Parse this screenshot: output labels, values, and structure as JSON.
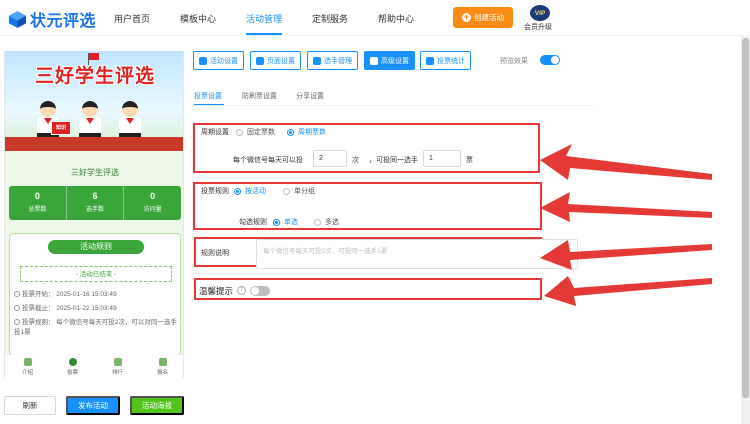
{
  "brand": {
    "name": "状元评选",
    "color": "#1a73e8"
  },
  "nav": {
    "items": [
      "用户首页",
      "模板中心",
      "活动管理",
      "定制服务",
      "帮助中心"
    ],
    "active_index": 2,
    "create_btn": "创建活动",
    "vip_badge": "VIP",
    "vip_label": "会员升级"
  },
  "preview": {
    "banner_title": "三好学生评选",
    "book_text": "知识",
    "poster_name": "三好学生评选",
    "stats": [
      {
        "value": "0",
        "label": "总票数"
      },
      {
        "value": "6",
        "label": "选手数"
      },
      {
        "value": "0",
        "label": "访问量"
      }
    ],
    "rules_title": "活动规则",
    "rules_status": "- 活动已结束 -",
    "rules": [
      "投票开始： 2025-01-16 15:03:49",
      "投票截止： 2025-01-22 15:03:49",
      "投票规则： 每个微信号每天可投2次，可以对同一选手投1票"
    ],
    "tabbar": [
      "介绍",
      "投票",
      "排行",
      "报名"
    ],
    "active_tab": 1
  },
  "footer_buttons": {
    "refresh": "刷新",
    "publish": "发布活动",
    "poster": "活动海报"
  },
  "toolbar": {
    "buttons": [
      "活动设置",
      "页面设置",
      "选手管理",
      "高级设置",
      "投票统计"
    ],
    "active_index": 3,
    "preview_label": "预览效果",
    "preview_on": true
  },
  "subtabs": {
    "items": [
      "投票设置",
      "防刷票设置",
      "分享设置"
    ],
    "active_index": 0
  },
  "settings": {
    "cycle": {
      "label": "周期设置",
      "options": [
        "固定票数",
        "周期票数"
      ],
      "selected": 1
    },
    "limit": {
      "prefix": "每个微信号每天可以投",
      "votes": "2",
      "unit1": "次",
      "middle": "，可投同一选手",
      "same": "1",
      "unit2": "票"
    },
    "rule": {
      "label": "投票规则",
      "options": [
        "按活动",
        "单分组"
      ],
      "selected": 0
    },
    "check": {
      "label": "勾选规则",
      "options": [
        "单选",
        "多选"
      ],
      "selected": 0
    },
    "desc": {
      "label": "规则说明",
      "placeholder": "每个微信号每天可投2次，可投同一选手1票"
    },
    "tip": {
      "label": "温馨提示",
      "help": "?",
      "enabled": false
    }
  },
  "colors": {
    "primary": "#1890ff",
    "highlight": "#e53935",
    "orange": "#fa8c16",
    "green": "#52c41a"
  }
}
